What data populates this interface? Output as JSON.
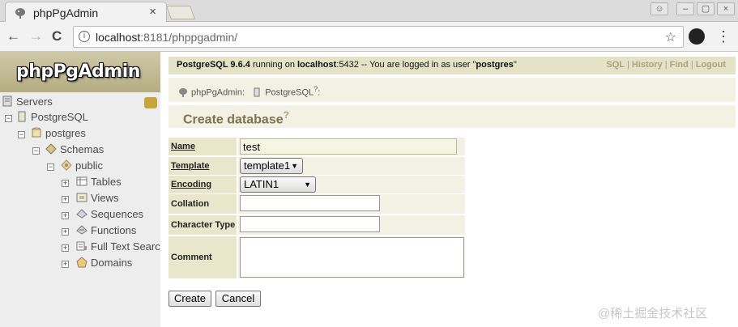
{
  "browser": {
    "tab_title": "phpPgAdmin",
    "tab_close": "×",
    "url_host": "localhost",
    "url_rest": ":8181/phppgadmin/",
    "back": "←",
    "forward": "→",
    "reload": "C",
    "info": "i",
    "star": "☆",
    "menu": "⋮"
  },
  "sidebar": {
    "logo": "phpPgAdmin",
    "tree": [
      {
        "label": "Servers",
        "icon": "servers-icon"
      },
      {
        "label": "PostgreSQL",
        "icon": "server-icon"
      },
      {
        "label": "postgres",
        "icon": "database-icon"
      },
      {
        "label": "Schemas",
        "icon": "schemas-icon"
      },
      {
        "label": "public",
        "icon": "schema-icon"
      },
      {
        "label": "Tables",
        "icon": "tables-icon"
      },
      {
        "label": "Views",
        "icon": "views-icon"
      },
      {
        "label": "Sequences",
        "icon": "sequences-icon"
      },
      {
        "label": "Functions",
        "icon": "functions-icon"
      },
      {
        "label": "Full Text Searc",
        "icon": "fulltext-icon"
      },
      {
        "label": "Domains",
        "icon": "domains-icon"
      }
    ]
  },
  "topbar": {
    "version": "PostgreSQL 9.6.4",
    "running_on": " running on ",
    "host": "localhost",
    "port_text": ":5432 -- You are logged in as user \"",
    "user": "postgres",
    "end_quote": "\"",
    "links": [
      "SQL",
      "History",
      "Find",
      "Logout"
    ]
  },
  "breadcrumb": {
    "item1": "phpPgAdmin:",
    "item2": "PostgreSQL",
    "item2_help": "?",
    "item2_colon": ":"
  },
  "page": {
    "title": "Create database",
    "help": "?"
  },
  "form": {
    "name_label": "Name",
    "name_value": "test",
    "template_label": "Template",
    "template_value": "template1",
    "encoding_label": "Encoding",
    "encoding_value": "LATIN1",
    "collation_label": "Collation",
    "collation_value": "",
    "ctype_label": "Character Type",
    "ctype_value": "",
    "comment_label": "Comment",
    "comment_value": "",
    "create_button": "Create",
    "cancel_button": "Cancel"
  },
  "watermark": "@稀土掘金技术社区",
  "colors": {
    "accent": "#e4e3c8",
    "label_bg": "#e8e6cb",
    "title": "#7b7451"
  }
}
